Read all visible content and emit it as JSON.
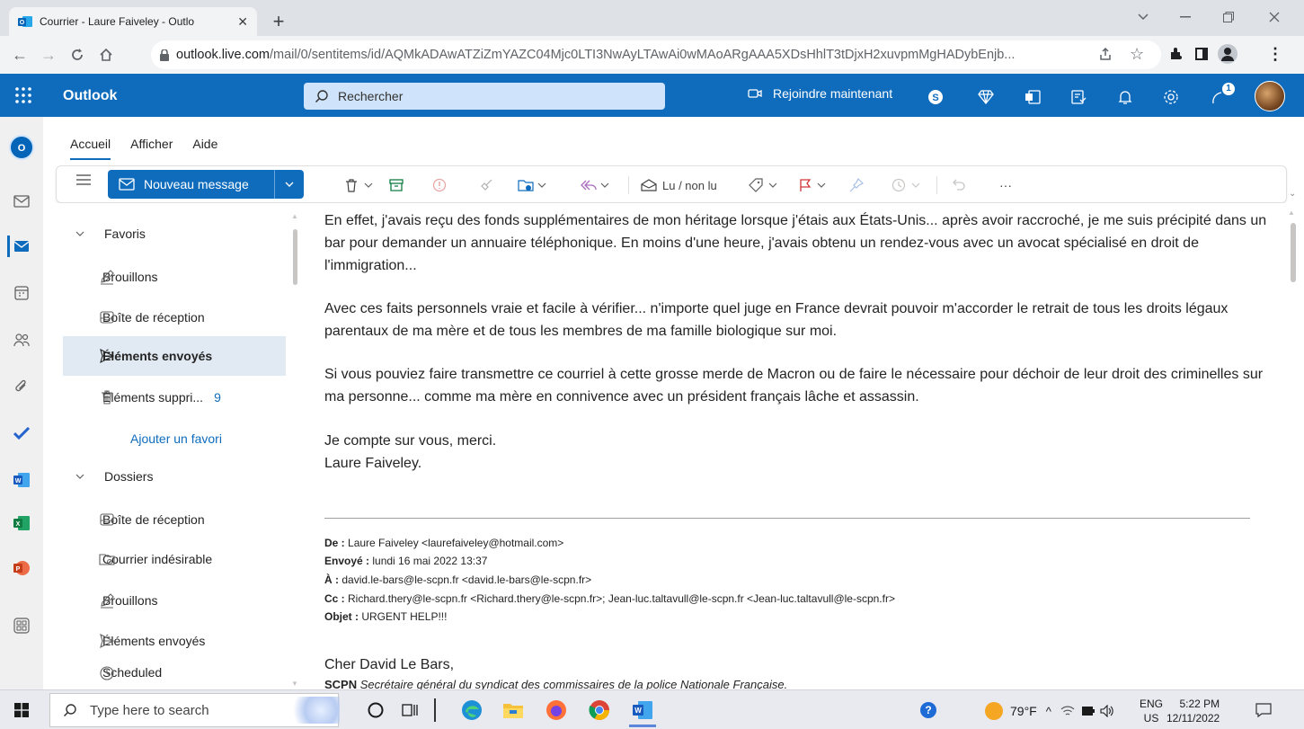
{
  "browser": {
    "tab_title": "Courrier - Laure Faiveley - Outlo",
    "url_host": "outlook.live.com",
    "url_path": "/mail/0/sentitems/id/AQMkADAwATZiZmYAZC04Mjc0LTI3NwAyLTAwAi0wMAoARgAAA5XDsHhlT3tDjxH2xuvpmMgHADybEnjb..."
  },
  "outlook": {
    "brand": "Outlook",
    "search_placeholder": "Rechercher",
    "join_label": "Rejoindre maintenant",
    "tips_badge": "1"
  },
  "ribbon": {
    "tabs": [
      "Accueil",
      "Afficher",
      "Aide"
    ],
    "new_message": "Nouveau message",
    "read_unread": "Lu / non lu",
    "more": "···"
  },
  "folders": {
    "favorites_label": "Favoris",
    "favorites": [
      {
        "label": "Brouillons"
      },
      {
        "label": "Boîte de réception"
      },
      {
        "label": "Éléments envoyés"
      },
      {
        "label": "Éléments suppri...",
        "count": "9"
      }
    ],
    "add_favorite": "Ajouter un favori",
    "folders_label": "Dossiers",
    "folders": [
      {
        "label": "Boîte de réception"
      },
      {
        "label": "Courrier indésirable"
      },
      {
        "label": "Brouillons"
      },
      {
        "label": "Éléments envoyés"
      },
      {
        "label": "Scheduled"
      }
    ]
  },
  "message": {
    "p1": "En effet, j'avais reçu des fonds supplémentaires de mon héritage lorsque j'étais aux États-Unis... après avoir raccroché, je me suis précipité dans un bar pour demander un annuaire téléphonique. En moins d'une heure, j'avais obtenu un rendez-vous avec un avocat spécialisé en droit de l'immigration...",
    "p2": "Avec ces faits personnels vraie et facile à vérifier... n'importe quel juge en France devrait pouvoir m'accorder le retrait de tous les droits légaux parentaux de ma mère et de tous les membres de ma famille biologique sur moi.",
    "p3": "Si vous pouviez faire transmettre ce courriel à cette grosse merde de Macron ou de faire le nécessaire pour déchoir de leur droit des criminelles sur ma personne... comme ma mère en connivence avec un président français lâche et assassin.",
    "closing": "Je compte sur vous, merci.",
    "signature": "Laure Faiveley.",
    "quoted": {
      "from_label": "De :",
      "from": "Laure Faiveley <laurefaiveley@hotmail.com>",
      "sent_label": "Envoyé :",
      "sent": "lundi 16 mai 2022 13:37",
      "to_label": "À :",
      "to": "david.le-bars@le-scpn.fr <david.le-bars@le-scpn.fr>",
      "cc_label": "Cc :",
      "cc": "Richard.thery@le-scpn.fr <Richard.thery@le-scpn.fr>; Jean-luc.taltavull@le-scpn.fr <Jean-luc.taltavull@le-scpn.fr>",
      "subject_label": "Objet :",
      "subject": "URGENT HELP!!!"
    },
    "greeting": "Cher David Le Bars,",
    "sig_org": "SCPN",
    "sig_title": "Secrétaire général du syndicat des commissaires de la police Nationale Française."
  },
  "taskbar": {
    "search_placeholder": "Type here to search",
    "weather": "79°F",
    "lang_1": "ENG",
    "lang_2": "US",
    "time": "5:22 PM",
    "date": "12/11/2022"
  },
  "colors": {
    "accent": "#0f6cbd",
    "selected_folder": "#e1eaf3"
  }
}
